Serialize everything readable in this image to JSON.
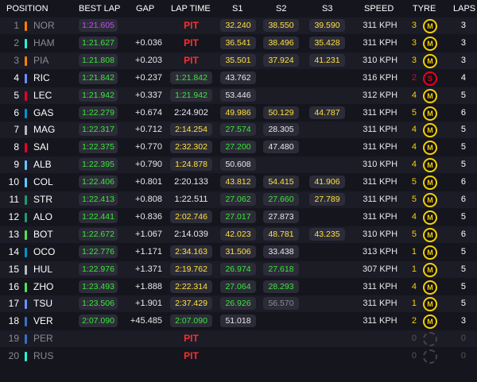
{
  "headers": {
    "position": "POSITION",
    "best_lap": "BEST LAP",
    "gap": "GAP",
    "lap_time": "LAP TIME",
    "s1": "S1",
    "s2": "S2",
    "s3": "S3",
    "speed": "SPEED",
    "tyre": "TYRE",
    "laps": "LAPS"
  },
  "colors": {
    "purple": "#c34bf5",
    "green": "#39e639",
    "yellow": "#ffe040",
    "white": "#e8e8ee",
    "pit": "#ff2e2e",
    "medium_tyre": "#f3cf0b",
    "soft_tyre": "#e8002d"
  },
  "rows": [
    {
      "pos": "1",
      "driver": "NOR",
      "team": "#ff8000",
      "best": "1:21.605",
      "best_c": "purple",
      "gap": "",
      "lap": "PIT",
      "lap_c": "pit",
      "s1": "32.240",
      "s1_c": "yellow",
      "s2": "38.550",
      "s2_c": "yellow",
      "s3": "39.590",
      "s3_c": "yellow",
      "speed": "311 KPH",
      "tlaps": "3",
      "tlaps_c": "yellow",
      "tyre": "M",
      "laps": "3",
      "dim": true
    },
    {
      "pos": "2",
      "driver": "HAM",
      "team": "#27f4d2",
      "best": "1:21.627",
      "best_c": "green",
      "gap": "+0.036",
      "lap": "PIT",
      "lap_c": "pit",
      "s1": "36.541",
      "s1_c": "yellow",
      "s2": "38.496",
      "s2_c": "yellow",
      "s3": "35.428",
      "s3_c": "yellow",
      "speed": "311 KPH",
      "tlaps": "3",
      "tlaps_c": "yellow",
      "tyre": "M",
      "laps": "3",
      "dim": true
    },
    {
      "pos": "3",
      "driver": "PIA",
      "team": "#ff8000",
      "best": "1:21.808",
      "best_c": "green",
      "gap": "+0.203",
      "lap": "PIT",
      "lap_c": "pit",
      "s1": "35.501",
      "s1_c": "yellow",
      "s2": "37.924",
      "s2_c": "yellow",
      "s3": "41.231",
      "s3_c": "yellow",
      "speed": "310 KPH",
      "tlaps": "3",
      "tlaps_c": "yellow",
      "tyre": "M",
      "laps": "3",
      "dim": true
    },
    {
      "pos": "4",
      "driver": "RIC",
      "team": "#6692ff",
      "best": "1:21.842",
      "best_c": "green",
      "gap": "+0.237",
      "lap": "1:21.842",
      "lap_c": "green",
      "s1": "43.762",
      "s1_c": "white",
      "s2": "",
      "s2_c": "white",
      "s3": "",
      "s3_c": "white",
      "speed": "316 KPH",
      "tlaps": "2",
      "tlaps_c": "red",
      "tyre": "S",
      "laps": "4",
      "dim": false
    },
    {
      "pos": "5",
      "driver": "LEC",
      "team": "#e8002d",
      "best": "1:21.942",
      "best_c": "green",
      "gap": "+0.337",
      "lap": "1:21.942",
      "lap_c": "green",
      "s1": "53.446",
      "s1_c": "white",
      "s2": "",
      "s2_c": "white",
      "s3": "",
      "s3_c": "white",
      "speed": "312 KPH",
      "tlaps": "4",
      "tlaps_c": "yellow",
      "tyre": "M",
      "laps": "5",
      "dim": false
    },
    {
      "pos": "6",
      "driver": "GAS",
      "team": "#0093cc",
      "best": "1:22.279",
      "best_c": "green",
      "gap": "+0.674",
      "lap": "2:24.902",
      "lap_c": "white",
      "s1": "49.986",
      "s1_c": "yellow",
      "s2": "50.129",
      "s2_c": "yellow",
      "s3": "44.787",
      "s3_c": "yellow",
      "speed": "311 KPH",
      "tlaps": "5",
      "tlaps_c": "yellow",
      "tyre": "M",
      "laps": "6",
      "dim": false
    },
    {
      "pos": "7",
      "driver": "MAG",
      "team": "#b6babd",
      "best": "1:22.317",
      "best_c": "green",
      "gap": "+0.712",
      "lap": "2:14.254",
      "lap_c": "yellow",
      "s1": "27.574",
      "s1_c": "green",
      "s2": "28.305",
      "s2_c": "white",
      "s3": "",
      "s3_c": "white",
      "speed": "311 KPH",
      "tlaps": "4",
      "tlaps_c": "yellow",
      "tyre": "M",
      "laps": "5",
      "dim": false
    },
    {
      "pos": "8",
      "driver": "SAI",
      "team": "#e8002d",
      "best": "1:22.375",
      "best_c": "green",
      "gap": "+0.770",
      "lap": "2:32.302",
      "lap_c": "yellow",
      "s1": "27.200",
      "s1_c": "green",
      "s2": "47.480",
      "s2_c": "white",
      "s3": "",
      "s3_c": "white",
      "speed": "311 KPH",
      "tlaps": "4",
      "tlaps_c": "yellow",
      "tyre": "M",
      "laps": "5",
      "dim": false
    },
    {
      "pos": "9",
      "driver": "ALB",
      "team": "#64c4ff",
      "best": "1:22.395",
      "best_c": "green",
      "gap": "+0.790",
      "lap": "1:24.878",
      "lap_c": "yellow",
      "s1": "50.608",
      "s1_c": "white",
      "s2": "",
      "s2_c": "white",
      "s3": "",
      "s3_c": "white",
      "speed": "310 KPH",
      "tlaps": "4",
      "tlaps_c": "yellow",
      "tyre": "M",
      "laps": "5",
      "dim": false
    },
    {
      "pos": "10",
      "driver": "COL",
      "team": "#64c4ff",
      "best": "1:22.406",
      "best_c": "green",
      "gap": "+0.801",
      "lap": "2:20.133",
      "lap_c": "white",
      "s1": "43.812",
      "s1_c": "yellow",
      "s2": "54.415",
      "s2_c": "yellow",
      "s3": "41.906",
      "s3_c": "yellow",
      "speed": "311 KPH",
      "tlaps": "5",
      "tlaps_c": "yellow",
      "tyre": "M",
      "laps": "6",
      "dim": false
    },
    {
      "pos": "11",
      "driver": "STR",
      "team": "#229971",
      "best": "1:22.413",
      "best_c": "green",
      "gap": "+0.808",
      "lap": "1:22.511",
      "lap_c": "white",
      "s1": "27.062",
      "s1_c": "green",
      "s2": "27.660",
      "s2_c": "green",
      "s3": "27.789",
      "s3_c": "yellow",
      "speed": "311 KPH",
      "tlaps": "5",
      "tlaps_c": "yellow",
      "tyre": "M",
      "laps": "6",
      "dim": false
    },
    {
      "pos": "12",
      "driver": "ALO",
      "team": "#229971",
      "best": "1:22.441",
      "best_c": "green",
      "gap": "+0.836",
      "lap": "2:02.746",
      "lap_c": "yellow",
      "s1": "27.017",
      "s1_c": "green",
      "s2": "27.873",
      "s2_c": "white",
      "s3": "",
      "s3_c": "white",
      "speed": "311 KPH",
      "tlaps": "4",
      "tlaps_c": "yellow",
      "tyre": "M",
      "laps": "5",
      "dim": false
    },
    {
      "pos": "13",
      "driver": "BOT",
      "team": "#52e252",
      "best": "1:22.672",
      "best_c": "green",
      "gap": "+1.067",
      "lap": "2:14.039",
      "lap_c": "white",
      "s1": "42.023",
      "s1_c": "yellow",
      "s2": "48.781",
      "s2_c": "yellow",
      "s3": "43.235",
      "s3_c": "yellow",
      "speed": "310 KPH",
      "tlaps": "5",
      "tlaps_c": "yellow",
      "tyre": "M",
      "laps": "6",
      "dim": false
    },
    {
      "pos": "14",
      "driver": "OCO",
      "team": "#0093cc",
      "best": "1:22.776",
      "best_c": "green",
      "gap": "+1.171",
      "lap": "2:34.163",
      "lap_c": "yellow",
      "s1": "31.506",
      "s1_c": "yellow",
      "s2": "33.438",
      "s2_c": "white",
      "s3": "",
      "s3_c": "white",
      "speed": "313 KPH",
      "tlaps": "1",
      "tlaps_c": "yellow",
      "tyre": "M",
      "laps": "5",
      "dim": false
    },
    {
      "pos": "15",
      "driver": "HUL",
      "team": "#b6babd",
      "best": "1:22.976",
      "best_c": "green",
      "gap": "+1.371",
      "lap": "2:19.762",
      "lap_c": "yellow",
      "s1": "26.974",
      "s1_c": "green",
      "s2": "27.618",
      "s2_c": "green",
      "s3": "",
      "s3_c": "white",
      "speed": "307 KPH",
      "tlaps": "1",
      "tlaps_c": "yellow",
      "tyre": "M",
      "laps": "5",
      "dim": false
    },
    {
      "pos": "16",
      "driver": "ZHO",
      "team": "#52e252",
      "best": "1:23.493",
      "best_c": "green",
      "gap": "+1.888",
      "lap": "2:22.314",
      "lap_c": "yellow",
      "s1": "27.064",
      "s1_c": "green",
      "s2": "28.293",
      "s2_c": "green",
      "s3": "",
      "s3_c": "white",
      "speed": "311 KPH",
      "tlaps": "4",
      "tlaps_c": "yellow",
      "tyre": "M",
      "laps": "5",
      "dim": false
    },
    {
      "pos": "17",
      "driver": "TSU",
      "team": "#6692ff",
      "best": "1:23.506",
      "best_c": "green",
      "gap": "+1.901",
      "lap": "2:37.429",
      "lap_c": "yellow",
      "s1": "26.926",
      "s1_c": "green",
      "s2": "56.570",
      "s2_c": "grey",
      "s3": "",
      "s3_c": "white",
      "speed": "311 KPH",
      "tlaps": "1",
      "tlaps_c": "yellow",
      "tyre": "M",
      "laps": "5",
      "dim": false
    },
    {
      "pos": "18",
      "driver": "VER",
      "team": "#3671c6",
      "best": "2:07.090",
      "best_c": "green",
      "gap": "+45.485",
      "lap": "2:07.090",
      "lap_c": "green",
      "s1": "51.018",
      "s1_c": "white",
      "s2": "",
      "s2_c": "white",
      "s3": "",
      "s3_c": "white",
      "speed": "311 KPH",
      "tlaps": "2",
      "tlaps_c": "yellow",
      "tyre": "M",
      "laps": "3",
      "dim": false
    },
    {
      "pos": "19",
      "driver": "PER",
      "team": "#3671c6",
      "best": "",
      "best_c": "green",
      "gap": "",
      "lap": "PIT",
      "lap_c": "pit",
      "s1": "",
      "s1_c": "white",
      "s2": "",
      "s2_c": "white",
      "s3": "",
      "s3_c": "white",
      "speed": "",
      "tlaps": "0",
      "tlaps_c": "grey",
      "tyre": "",
      "laps": "0",
      "dim": true
    },
    {
      "pos": "20",
      "driver": "RUS",
      "team": "#27f4d2",
      "best": "",
      "best_c": "green",
      "gap": "",
      "lap": "PIT",
      "lap_c": "pit",
      "s1": "",
      "s1_c": "white",
      "s2": "",
      "s2_c": "white",
      "s3": "",
      "s3_c": "white",
      "speed": "",
      "tlaps": "0",
      "tlaps_c": "grey",
      "tyre": "",
      "laps": "0",
      "dim": true
    }
  ]
}
